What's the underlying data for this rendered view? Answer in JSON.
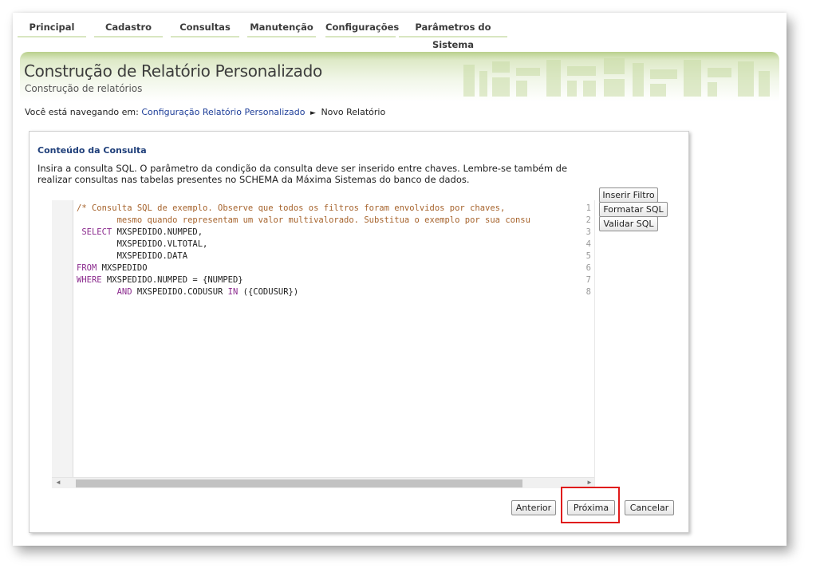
{
  "nav": {
    "items": [
      "Principal",
      "Cadastro",
      "Consultas",
      "Manutenção",
      "Configurações",
      "Parâmetros do Sistema"
    ]
  },
  "header": {
    "title": "Construção de Relatório Personalizado",
    "subtitle": "Construção de relatórios"
  },
  "breadcrumb": {
    "prefix": "Você está navegando em:",
    "link": "Configuração Relatório Personalizado",
    "separator": "►",
    "current": "Novo Relatório"
  },
  "panel": {
    "title": "Conteúdo da Consulta",
    "description": "Insira a consulta SQL. O parâmetro da condição da consulta deve ser inserido entre chaves. Lembre-se também de realizar consultas nas tabelas presentes no SCHEMA da Máxima Sistemas do banco de dados."
  },
  "editor": {
    "line_numbers": [
      "1",
      "2",
      "3",
      "4",
      "5",
      "6",
      "7",
      "8"
    ],
    "lines": [
      [
        {
          "t": "/* Consulta SQL de exemplo. Observe que todos os filtros foram envolvidos por chaves,",
          "c": "com"
        }
      ],
      [
        {
          "t": "        mesmo quando representam um valor multivalorado. Substitua o exemplo por sua consu",
          "c": "com"
        }
      ],
      [
        {
          "t": " SELECT",
          "c": "kw"
        },
        {
          "t": " MXSPEDIDO.NUMPED,",
          "c": ""
        }
      ],
      [
        {
          "t": "        MXSPEDIDO.VLTOTAL,",
          "c": ""
        }
      ],
      [
        {
          "t": "        MXSPEDIDO.DATA",
          "c": ""
        }
      ],
      [
        {
          "t": "FROM",
          "c": "kw"
        },
        {
          "t": " MXSPEDIDO",
          "c": ""
        }
      ],
      [
        {
          "t": "WHERE",
          "c": "kw"
        },
        {
          "t": " MXSPEDIDO.NUMPED = {NUMPED}",
          "c": ""
        }
      ],
      [
        {
          "t": "        AND",
          "c": "kw"
        },
        {
          "t": " MXSPEDIDO.CODUSUR ",
          "c": ""
        },
        {
          "t": "IN",
          "c": "kw"
        },
        {
          "t": " ({CODUSUR})",
          "c": ""
        }
      ]
    ]
  },
  "tools": {
    "insert_filter": "Inserir Filtro",
    "format_sql": "Formatar SQL",
    "validate_sql": "Validar SQL"
  },
  "actions": {
    "previous": "Anterior",
    "next": "Próxima",
    "cancel": "Cancelar"
  },
  "colors": {
    "comment": "#a6632c",
    "keyword": "#8b2b8e",
    "highlight": "#e01b1b",
    "link": "#1f3f99"
  }
}
